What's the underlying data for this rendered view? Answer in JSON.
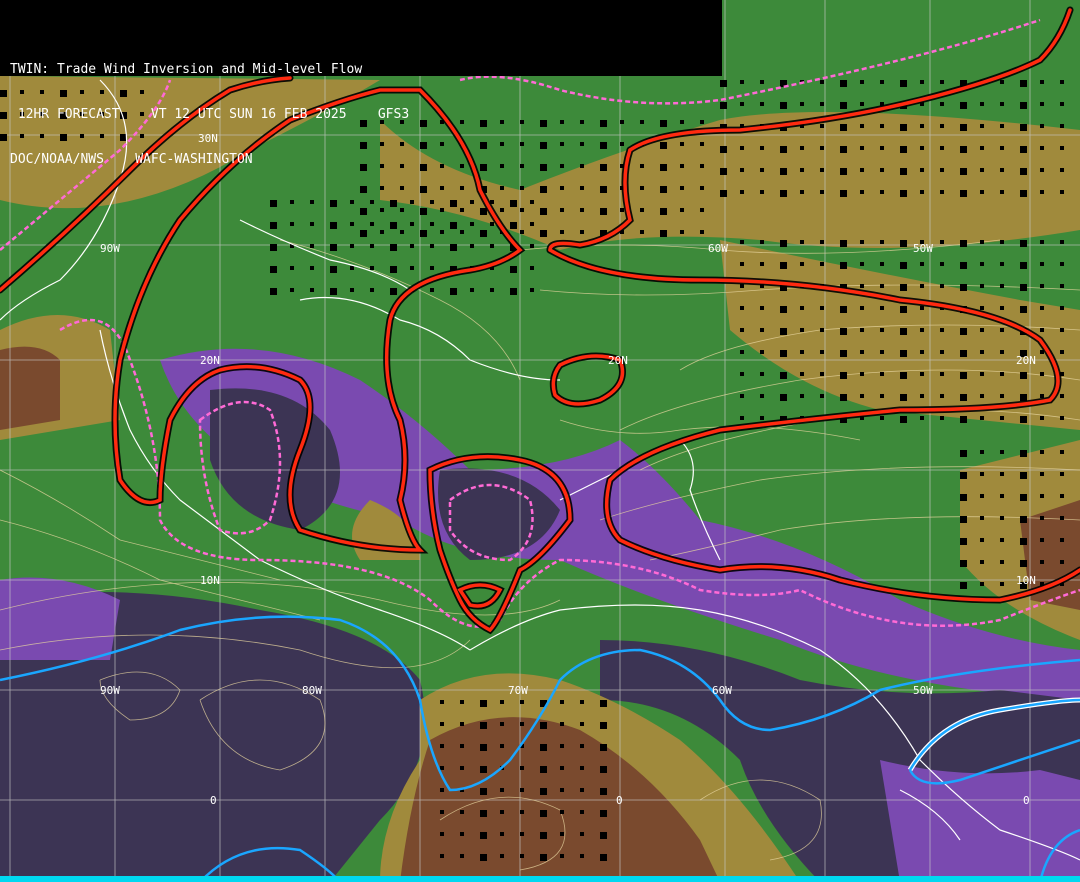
{
  "header": {
    "title": "TWIN: Trade Wind Inversion and Mid-level Flow",
    "forecast_line": " 12HR FORECAST    VT 12 UTC SUN 16 FEB 2025    GFS3",
    "agency_line": "DOC/NOAA/NWS    WAFC-WASHINGTON"
  },
  "grid_labels": {
    "lat": [
      "30N",
      "20N",
      "10N",
      "0"
    ],
    "lon": [
      "90W",
      "80W",
      "70W",
      "60W",
      "50W"
    ],
    "lat_30_row": [
      "30N"
    ],
    "lat_20_row": [
      "20N",
      "20N",
      "20N"
    ],
    "lat_10_row": [
      "10N",
      "10N"
    ],
    "lon_upper_row": [
      "90W",
      "60W",
      "50W"
    ],
    "lon_lower_row": [
      "90W",
      "80W",
      "70W",
      "60W",
      "50W"
    ],
    "equator_row": [
      "0",
      "0",
      "0"
    ]
  },
  "colors": {
    "background_green": "#3d8a3a",
    "light_green": "#5e9e4a",
    "tan": "#a08a3c",
    "brown": "#7a4a2e",
    "dark_purple": "#3c3454",
    "purple": "#7a4ab0",
    "inversion_contour": "#ff2a10",
    "dashed_contour": "#ff6ad6",
    "jet_line": "#1aa6ff",
    "streamline": "#e8d6a0",
    "coastline": "#ffffff",
    "grid": "#c8c8c8"
  }
}
